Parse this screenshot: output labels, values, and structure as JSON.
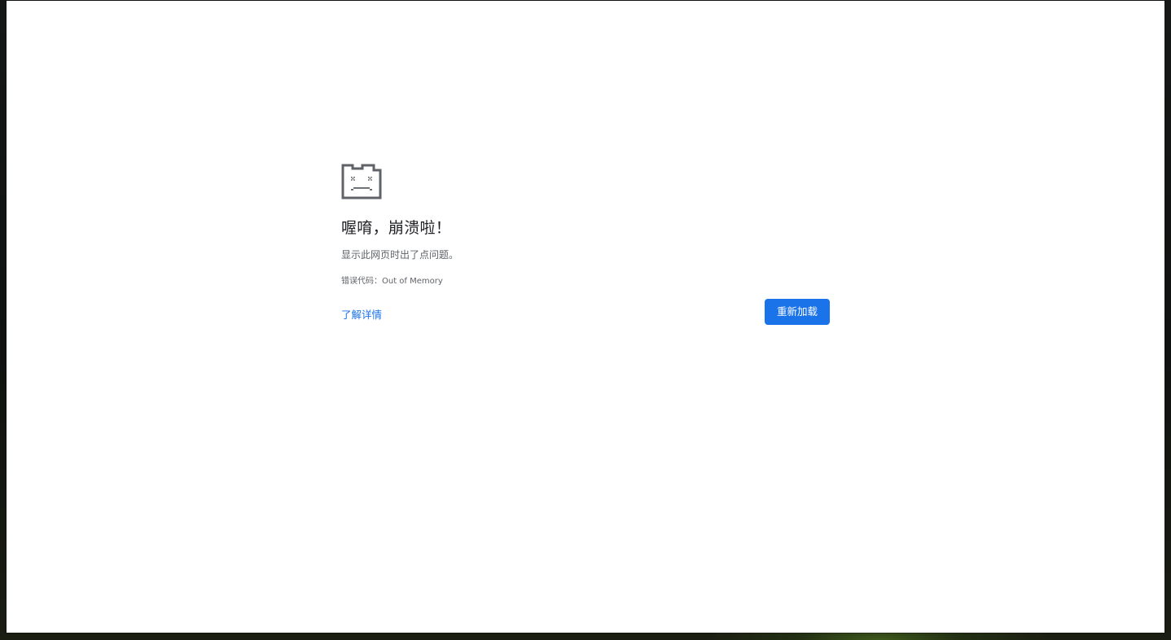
{
  "page": {
    "title": "喔唷，崩溃啦！",
    "message": "显示此网页时出了点问题。",
    "error_code_label": "错误代码：",
    "error_code": "Out of Memory",
    "learn_more_label": "了解详情",
    "reload_label": "重新加载"
  },
  "icons": {
    "crash": "sad-tab-icon"
  },
  "colors": {
    "accent": "#1a73e8",
    "title_text": "#202124",
    "secondary_text": "#5f6368",
    "icon_stroke": "#5f6368",
    "window_background": "#ffffff"
  }
}
